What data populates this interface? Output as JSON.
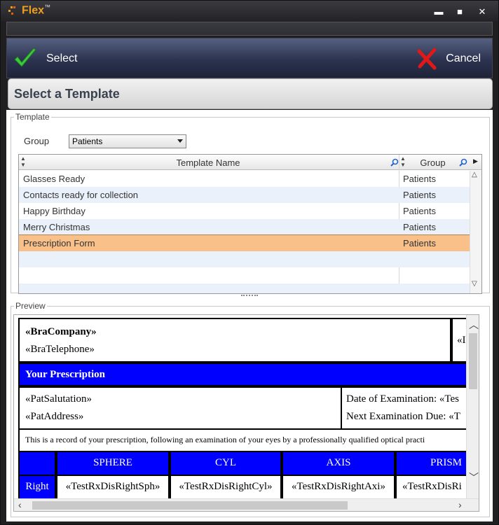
{
  "window": {
    "app_title": "Flex",
    "trademark": "™",
    "minimize": "▬",
    "maximize": "■",
    "close": "✕"
  },
  "toolbar": {
    "select_label": "Select",
    "cancel_label": "Cancel"
  },
  "header": {
    "title": "Select a Template"
  },
  "template_section": {
    "legend": "Template",
    "group_label": "Group",
    "group_value": "Patients",
    "columns": {
      "name": "Template Name",
      "group": "Group"
    },
    "rows": [
      {
        "name": "Glasses Ready",
        "group": "Patients",
        "selected": false
      },
      {
        "name": "Contacts ready for collection",
        "group": "Patients",
        "selected": false
      },
      {
        "name": "Happy Birthday",
        "group": "Patients",
        "selected": false
      },
      {
        "name": "Merry Christmas",
        "group": "Patients",
        "selected": false
      },
      {
        "name": "Prescription Form",
        "group": "Patients",
        "selected": true
      }
    ]
  },
  "preview_section": {
    "legend": "Preview",
    "company": "«BraCompany»",
    "telephone": "«BraTelephone»",
    "right_cut": "«I",
    "band_title": "Your Prescription",
    "salutation": "«PatSalutation»",
    "address": "«PatAddress»",
    "date_exam": "Date of Examination: «Tes",
    "next_exam": "Next Examination Due: «T",
    "record_text": "This is a record of your prescription, following an examination of your eyes by a professionally qualified optical practi",
    "col_headers": [
      "SPHERE",
      "CYL",
      "AXIS",
      "PRISM"
    ],
    "row_label": "Right",
    "row_values": [
      "«TestRxDisRightSph»",
      "«TestRxDisRightCyl»",
      "«TestRxDisRightAxi»",
      "«TestRxDisRi"
    ]
  },
  "colors": {
    "accent_selected": "#f9c08a",
    "doc_blue": "#0000ff",
    "title_orange": "#f0a020"
  }
}
